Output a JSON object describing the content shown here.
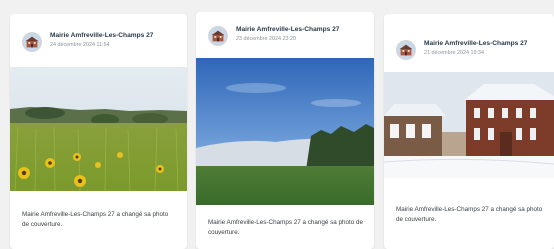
{
  "posts": [
    {
      "author": "Mairie Amfreville-Les-Champs 27",
      "date": "24 décembre 2024 11:54",
      "caption": "Mairie Amfreville-Les-Champs 27 a changé sa photo de couverture.",
      "photo": "sunflower-field-photo"
    },
    {
      "author": "Mairie Amfreville-Les-Champs 27",
      "date": "23 décembre 2024 23:20",
      "caption": "Mairie Amfreville-Les-Champs 27 a changé sa photo de couverture.",
      "photo": "misty-valley-photo"
    },
    {
      "author": "Mairie Amfreville-Les-Champs 27",
      "date": "21 décembre 2024 19:34",
      "caption": "Mairie Amfreville-Les-Champs 27 a changé sa photo de couverture.",
      "photo": "snowy-town-hall-photo"
    }
  ]
}
